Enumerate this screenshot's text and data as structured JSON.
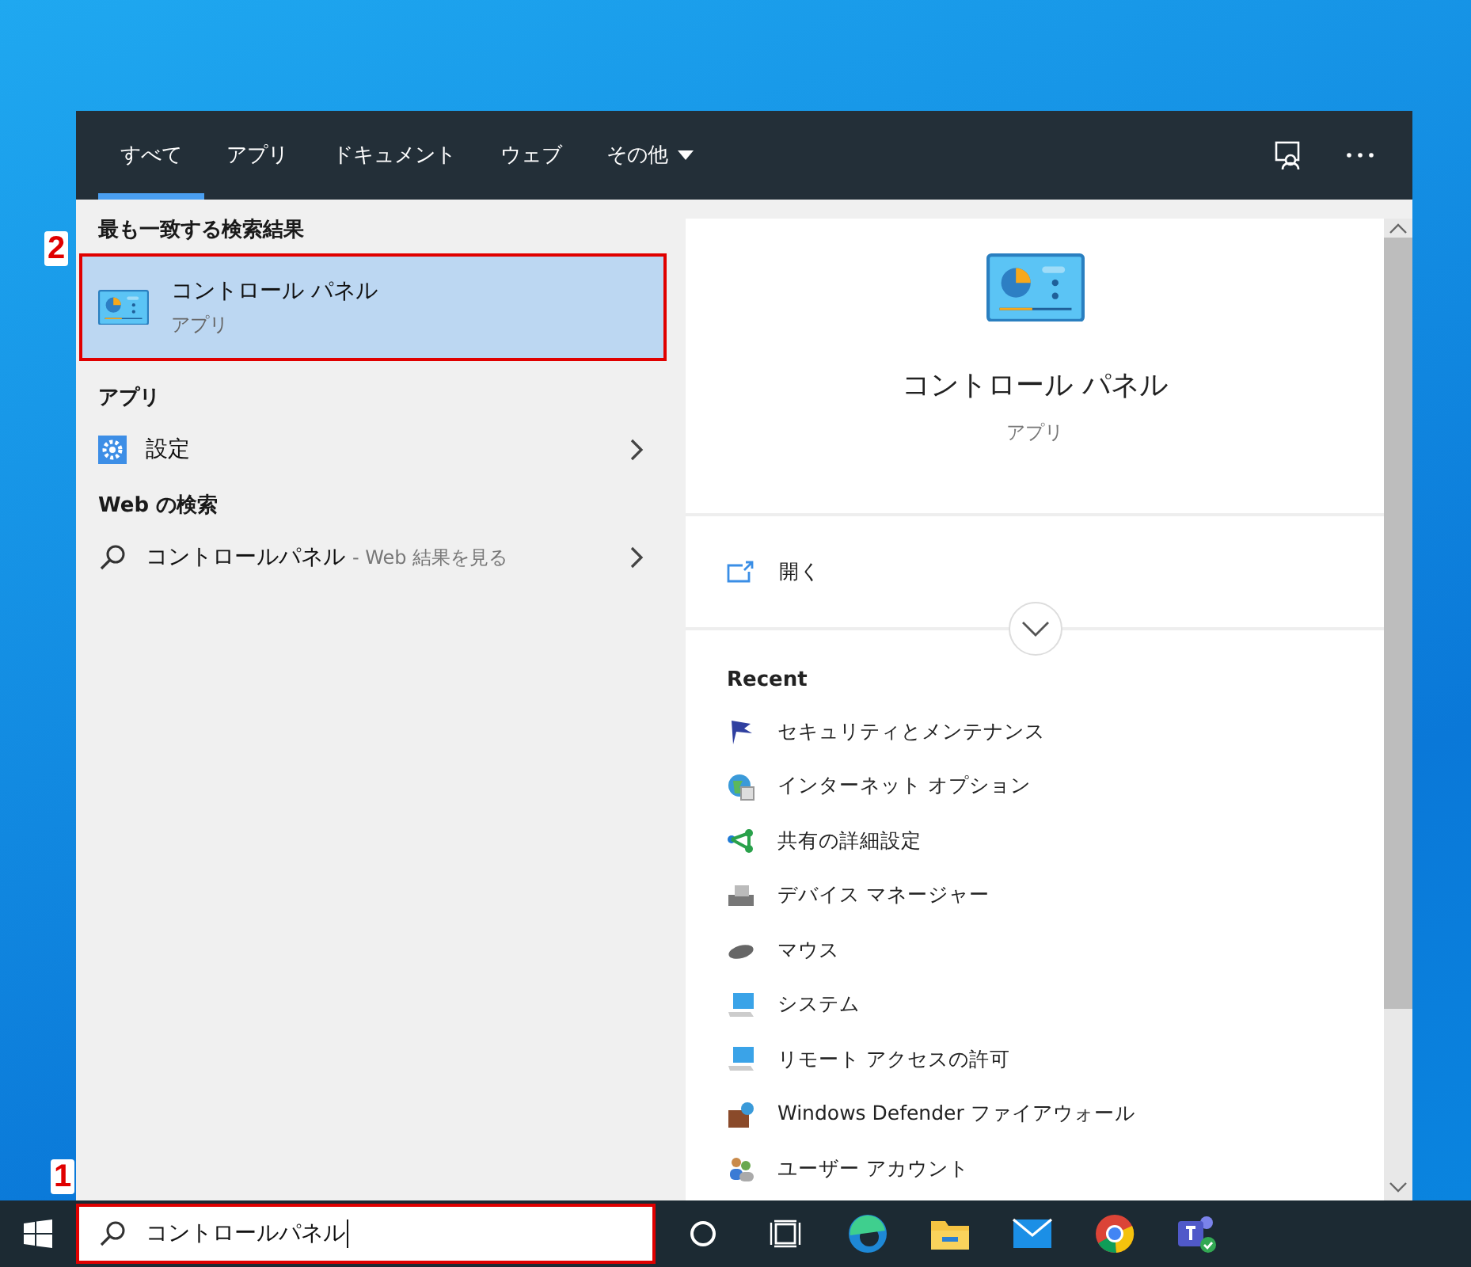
{
  "tabs": [
    {
      "label": "すべて",
      "selected": true,
      "kind": "plain"
    },
    {
      "label": "アプリ",
      "selected": false,
      "kind": "plain"
    },
    {
      "label": "ドキュメント",
      "selected": false,
      "kind": "plain"
    },
    {
      "label": "ウェブ",
      "selected": false,
      "kind": "plain"
    },
    {
      "label": "その他",
      "selected": false,
      "kind": "dropdown"
    }
  ],
  "best_match": {
    "heading": "最も一致する検索結果",
    "title": "コントロール パネル",
    "subtitle": "アプリ",
    "selected": true,
    "callout": "2"
  },
  "apps": {
    "heading": "アプリ",
    "items": [
      {
        "label": "設定"
      }
    ]
  },
  "web": {
    "heading": "Web の検索",
    "items": [
      {
        "query": "コントロールパネル",
        "suffix": "- Web 結果を見る"
      }
    ]
  },
  "preview": {
    "title": "コントロール パネル",
    "subtitle": "アプリ",
    "actions": [
      {
        "label": "開く"
      }
    ],
    "recent_heading": "Recent",
    "recent": [
      {
        "label": "セキュリティとメンテナンス"
      },
      {
        "label": "インターネット オプション"
      },
      {
        "label": "共有の詳細設定"
      },
      {
        "label": "デバイス マネージャー"
      },
      {
        "label": "マウス"
      },
      {
        "label": "システム"
      },
      {
        "label": "リモート アクセスの許可"
      },
      {
        "label": "Windows Defender ファイアウォール"
      },
      {
        "label": "ユーザー アカウント"
      }
    ]
  },
  "taskbar": {
    "search": {
      "value": "コントロールパネル",
      "callout": "1"
    }
  }
}
